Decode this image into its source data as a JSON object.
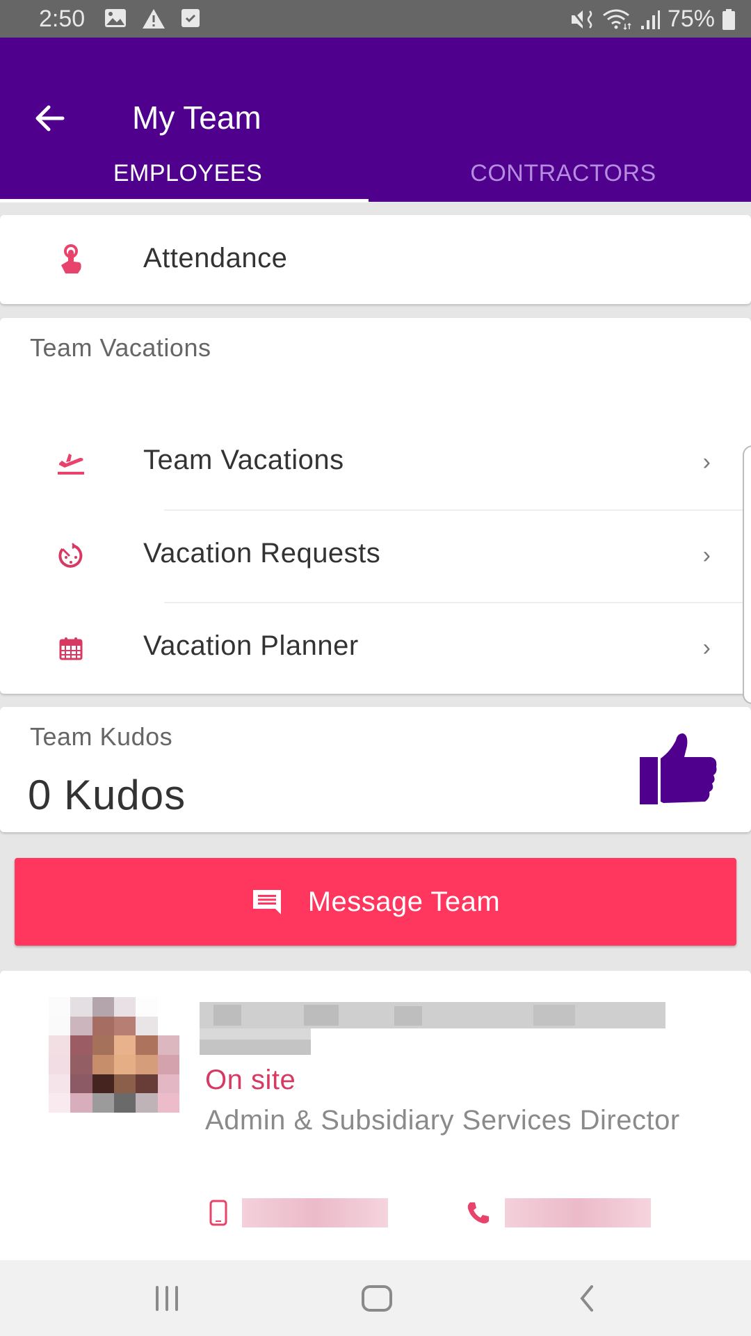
{
  "status_bar": {
    "time": "2:50",
    "left_icons": [
      "image-icon",
      "warning-icon",
      "task-done-icon"
    ],
    "right_icons": [
      "vibrate-mute-icon",
      "wifi-icon",
      "signal-icon"
    ],
    "battery": "75%"
  },
  "app_bar": {
    "title": "My Team",
    "back_icon": "arrow-back-icon"
  },
  "tabs": [
    {
      "label": "EMPLOYEES",
      "active": true
    },
    {
      "label": "CONTRACTORS",
      "active": false
    }
  ],
  "attendance": {
    "label": "Attendance",
    "icon": "touch-icon"
  },
  "vacations": {
    "section_title": "Team Vacations",
    "items": [
      {
        "label": "Team Vacations",
        "icon": "flight-takeoff-icon"
      },
      {
        "label": "Vacation Requests",
        "icon": "timer-icon"
      },
      {
        "label": "Vacation Planner",
        "icon": "calendar-icon"
      }
    ]
  },
  "kudos": {
    "section_title": "Team Kudos",
    "count": "0 Kudos",
    "icon": "thumbs-up-icon"
  },
  "message_button": {
    "label": "Message Team",
    "icon": "chat-icon"
  },
  "employee": {
    "status": "On site",
    "job_title": "Admin & Subsidiary Services Director"
  },
  "colors": {
    "primary": "#4f008c",
    "accent": "#ff375e",
    "status_text": "#d63a62"
  }
}
